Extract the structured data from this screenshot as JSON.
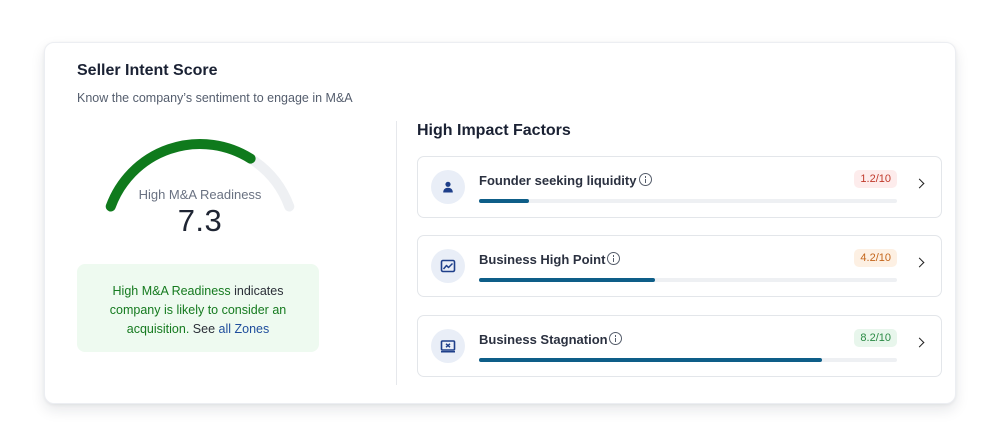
{
  "card": {
    "title": "Seller Intent Score",
    "subtitle": "Know the company’s sentiment to engage in M&A"
  },
  "gauge": {
    "label": "High M&A Readiness",
    "value": "7.3",
    "score": 7.3,
    "max": 10,
    "fill_color": "#0f7a1c",
    "track_color": "#eef0f3"
  },
  "note": {
    "highlight": "High M&A Readiness",
    "text1": " indicates ",
    "text2": "company is likely to consider an",
    "text3": "acquisition.",
    "text4": " See ",
    "link": "all Zones"
  },
  "factors": {
    "title": "High Impact Factors",
    "items": [
      {
        "name": "Founder seeking liquidity",
        "score": "1.2/10",
        "value": 1.2,
        "icon": "person-icon",
        "badge_bg": "#fdecec",
        "badge_color": "#c0392b"
      },
      {
        "name": "Business High Point",
        "score": "4.2/10",
        "value": 4.2,
        "icon": "trend-chart-icon",
        "badge_bg": "#fdf0e3",
        "badge_color": "#c4651a"
      },
      {
        "name": "Business Stagnation",
        "score": "8.2/10",
        "value": 8.2,
        "icon": "stagnation-chart-icon",
        "badge_bg": "#e8f6ec",
        "badge_color": "#2a8a44"
      }
    ]
  }
}
